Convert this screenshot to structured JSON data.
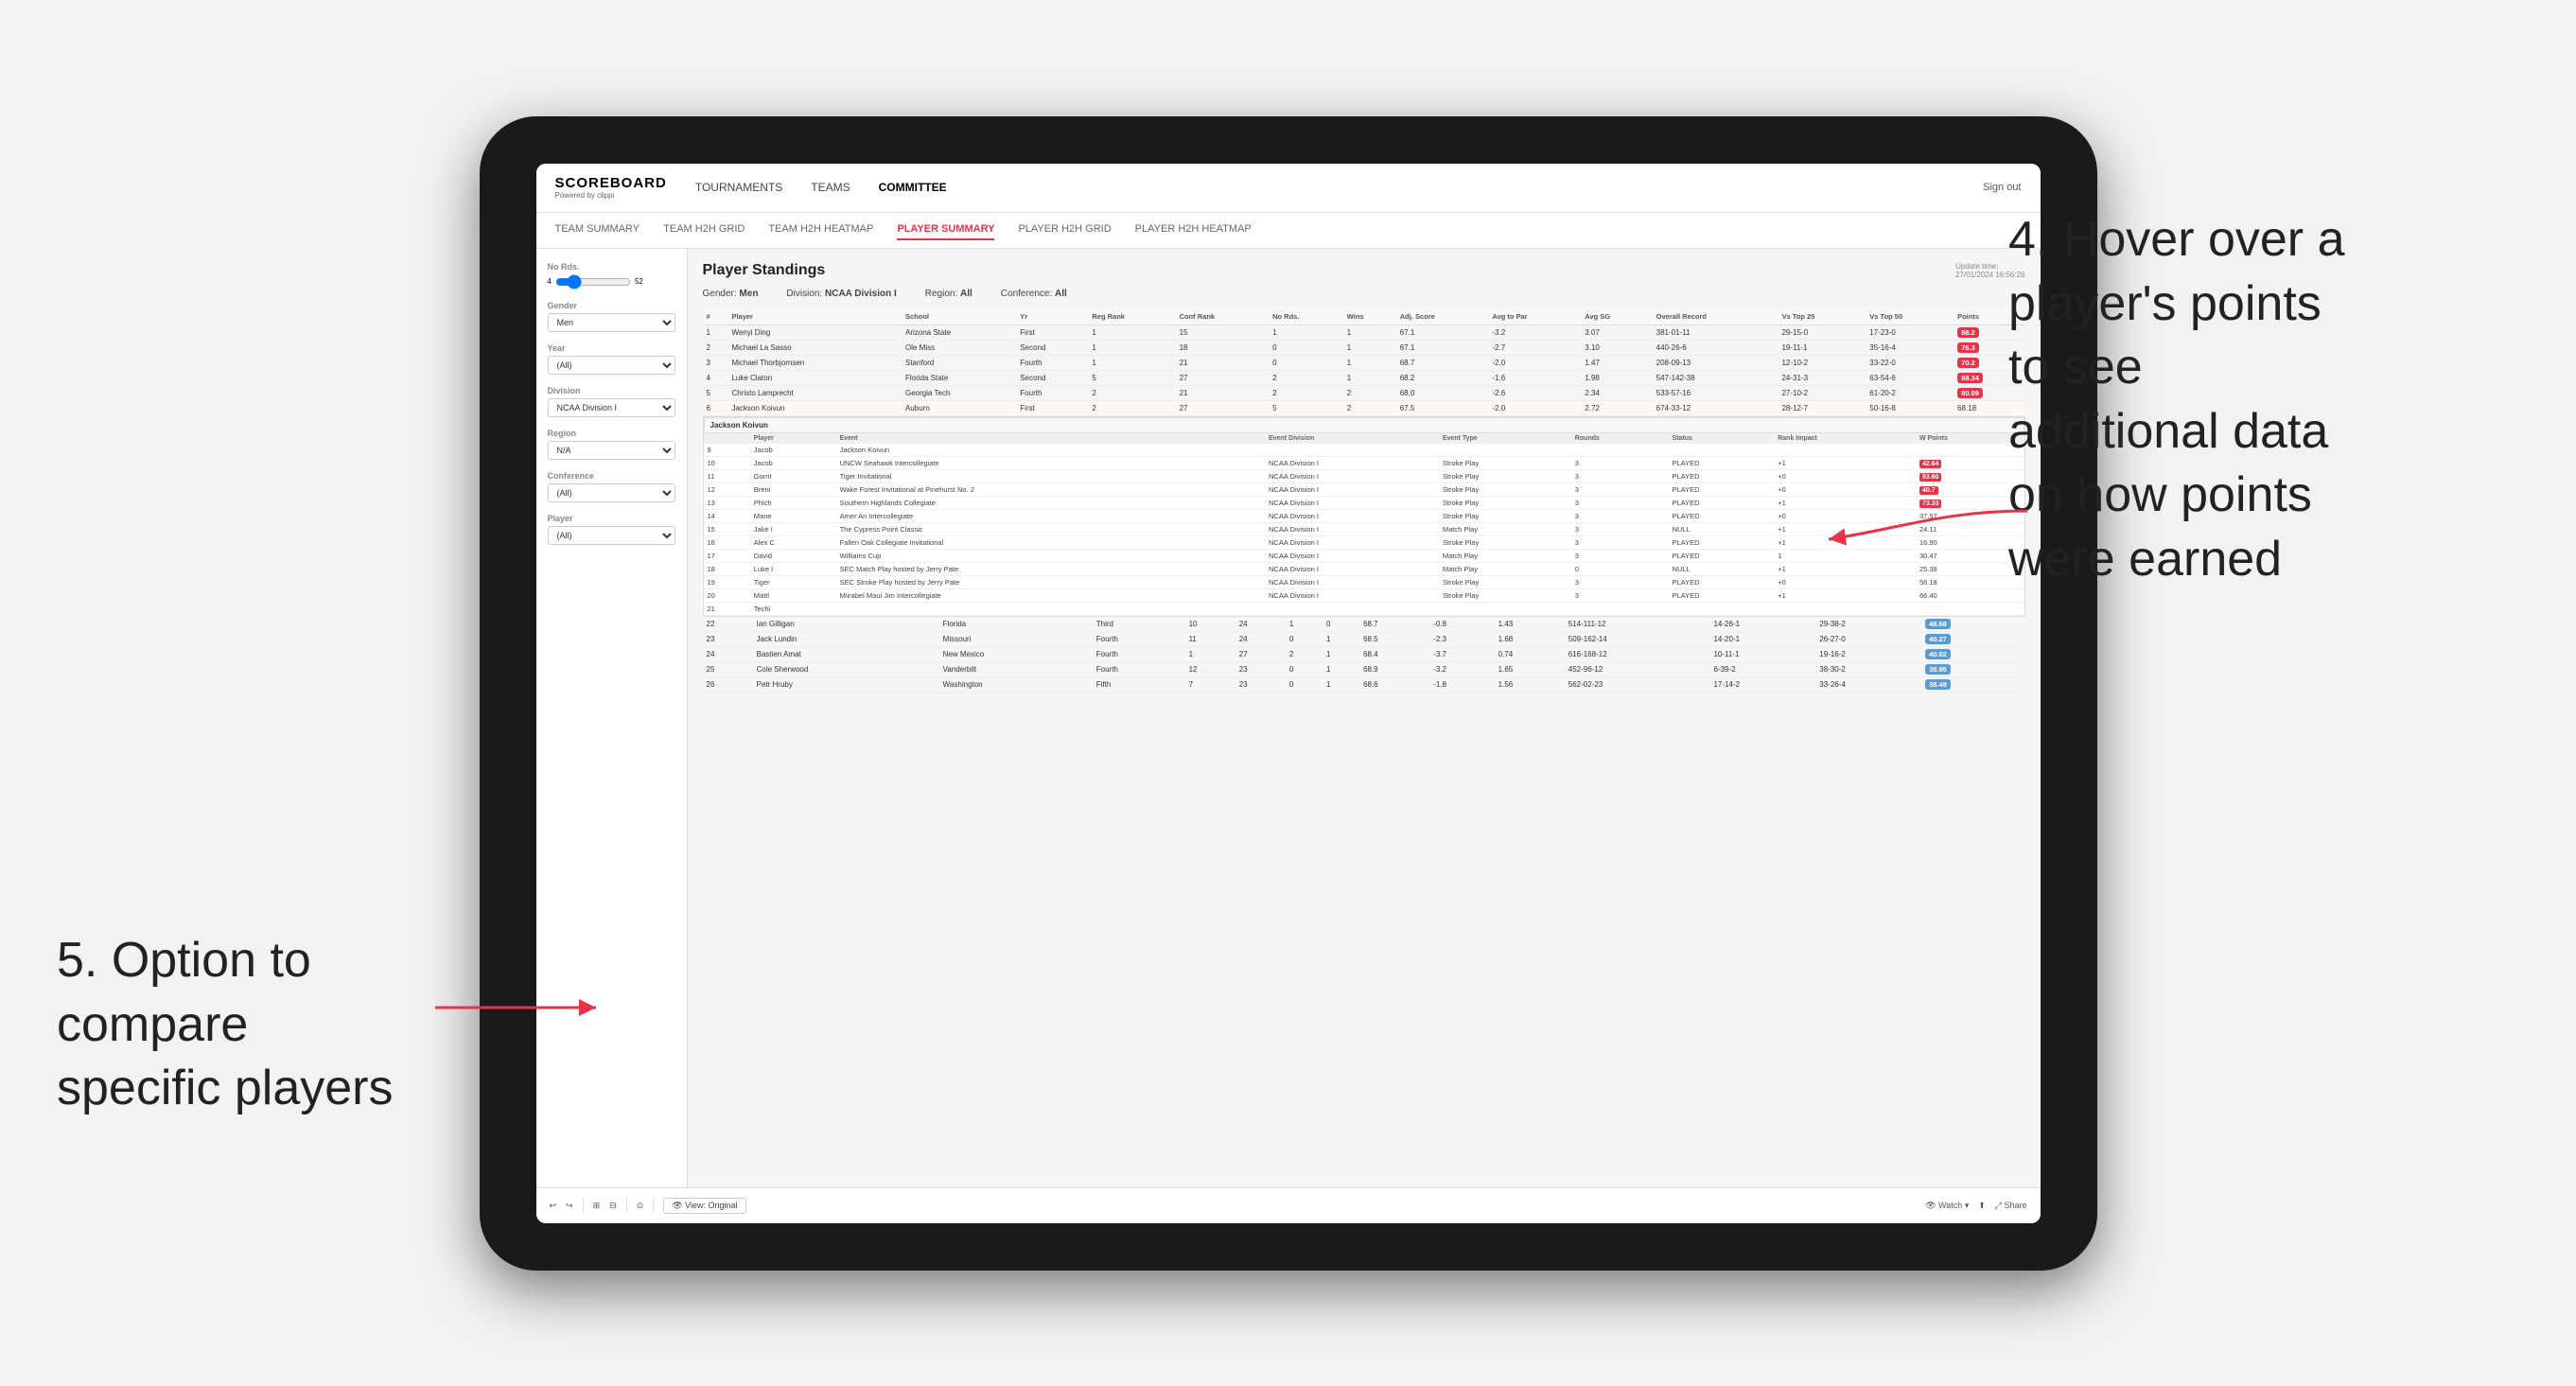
{
  "annotations": {
    "top_right": "4. Hover over a\nplayer's points\nto see\nadditional data\non how points\nwere earned",
    "bottom_left": "5. Option to\ncompare\nspecific players"
  },
  "nav": {
    "logo": "SCOREBOARD",
    "logo_sub": "Powered by clippi",
    "items": [
      "TOURNAMENTS",
      "TEAMS",
      "COMMITTEE"
    ],
    "sign_in": "Sign out"
  },
  "sub_nav": {
    "items": [
      "TEAM SUMMARY",
      "TEAM H2H GRID",
      "TEAM H2H HEATMAP",
      "PLAYER SUMMARY",
      "PLAYER H2H GRID",
      "PLAYER H2H HEATMAP"
    ],
    "active": "PLAYER SUMMARY"
  },
  "sidebar": {
    "no_rds_label": "No Rds.",
    "no_rds_from": "4",
    "no_rds_to": "52",
    "gender_label": "Gender",
    "gender_value": "Men",
    "year_label": "Year",
    "year_value": "(All)",
    "division_label": "Division",
    "division_value": "NCAA Division I",
    "region_label": "Region",
    "region_value": "N/A",
    "conference_label": "Conference",
    "conference_value": "(All)",
    "player_label": "Player",
    "player_value": "(All)"
  },
  "main": {
    "update_time": "Update time:",
    "update_date": "27/01/2024 16:56:26",
    "title": "Player Standings",
    "filters": {
      "gender": "Gender: Men",
      "division": "Division: NCAA Division I",
      "region": "Region: All",
      "conference": "Conference: All"
    },
    "table_headers": [
      "#",
      "Player",
      "School",
      "Yr",
      "Reg Rank",
      "Conf Rank",
      "No Rds.",
      "Wins",
      "Adj. Score",
      "Avg to Par",
      "Avg SG",
      "Overall Record",
      "Vs Top 25",
      "Vs Top 50",
      "Points"
    ],
    "rows": [
      {
        "rank": 1,
        "player": "Wenyi Ding",
        "school": "Arizona State",
        "yr": "First",
        "reg_rank": 1,
        "conf_rank": 15,
        "rds": 1,
        "wins": 1,
        "adj_score": 67.1,
        "to_par": -3.2,
        "avg_sg": 3.07,
        "record": "381-01-11",
        "vs25": "29-15-0",
        "vs50": "17-23-0",
        "points": "88.2",
        "points_type": "red"
      },
      {
        "rank": 2,
        "player": "Michael La Sasso",
        "school": "Ole Miss",
        "yr": "Second",
        "reg_rank": 1,
        "conf_rank": 18,
        "rds": 0,
        "wins": 1,
        "adj_score": 67.1,
        "to_par": -2.7,
        "avg_sg": 3.1,
        "record": "440-26-6",
        "vs25": "19-11-1",
        "vs50": "35-16-4",
        "points": "76.3",
        "points_type": "red"
      },
      {
        "rank": 3,
        "player": "Michael Thorbjornsen",
        "school": "Stanford",
        "yr": "Fourth",
        "reg_rank": 1,
        "conf_rank": 21,
        "rds": 0,
        "wins": 1,
        "adj_score": 68.7,
        "to_par": -2.0,
        "avg_sg": 1.47,
        "record": "208-09-13",
        "vs25": "12-10-2",
        "vs50": "33-22-0",
        "points": "70.2",
        "points_type": "red"
      },
      {
        "rank": 4,
        "player": "Luke Claton",
        "school": "Florida State",
        "yr": "Second",
        "reg_rank": 5,
        "conf_rank": 27,
        "rds": 2,
        "wins": 1,
        "adj_score": 68.2,
        "to_par": -1.6,
        "avg_sg": 1.98,
        "record": "547-142-38",
        "vs25": "24-31-3",
        "vs50": "63-54-6",
        "points": "88.34",
        "points_type": "red"
      },
      {
        "rank": 5,
        "player": "Christo Lamprecht",
        "school": "Georgia Tech",
        "yr": "Fourth",
        "reg_rank": 2,
        "conf_rank": 21,
        "rds": 2,
        "wins": 2,
        "adj_score": 68.0,
        "to_par": -2.6,
        "avg_sg": 2.34,
        "record": "533-57-16",
        "vs25": "27-10-2",
        "vs50": "61-20-2",
        "points": "80.09",
        "points_type": "red"
      },
      {
        "rank": 6,
        "player": "Jackson Koivun",
        "school": "Auburn",
        "yr": "First",
        "reg_rank": 2,
        "conf_rank": 27,
        "rds": 5,
        "wins": 2,
        "adj_score": 67.5,
        "to_par": -2.0,
        "avg_sg": 2.72,
        "record": "674-33-12",
        "vs25": "28-12-7",
        "vs50": "50-16-8",
        "points": "68.18",
        "points_type": "none"
      }
    ],
    "tooltip_player": "Jackson Koivun",
    "tooltip_rows": [
      {
        "event": "UNCW Seahawk Intercollegiate",
        "division": "NCAA Division I",
        "type": "Stroke Play",
        "rounds": 3,
        "status": "PLAYED",
        "rank_impact": "+1",
        "w_points": "42.64",
        "wp_type": "red"
      },
      {
        "event": "Tiger Invitational",
        "division": "NCAA Division I",
        "type": "Stroke Play",
        "rounds": 3,
        "status": "PLAYED",
        "rank_impact": "+0",
        "w_points": "53.60",
        "wp_type": "red"
      },
      {
        "event": "Wake Forest Invitational at Pinehurst No. 2",
        "division": "NCAA Division I",
        "type": "Stroke Play",
        "rounds": 3,
        "status": "PLAYED",
        "rank_impact": "+0",
        "w_points": "40.7",
        "wp_type": "red"
      },
      {
        "event": "Southern Highlands Collegiate",
        "division": "NCAA Division I",
        "type": "Stroke Play",
        "rounds": 3,
        "status": "PLAYED",
        "rank_impact": "+1",
        "w_points": "73.33",
        "wp_type": "red"
      },
      {
        "event": "Amer An Intercollegiate",
        "division": "NCAA Division I",
        "type": "Stroke Play",
        "rounds": 3,
        "status": "PLAYED",
        "rank_impact": "+0",
        "w_points": "37.57",
        "wp_type": "none"
      },
      {
        "event": "The Cypress Point Classic",
        "division": "NCAA Division I",
        "type": "Match Play",
        "rounds": 3,
        "status": "NULL",
        "rank_impact": "+1",
        "w_points": "24.11",
        "wp_type": "none"
      },
      {
        "event": "Fallen Oak Collegiate Invitational",
        "division": "NCAA Division I",
        "type": "Stroke Play",
        "rounds": 3,
        "status": "PLAYED",
        "rank_impact": "+1",
        "w_points": "16.90",
        "wp_type": "none"
      },
      {
        "event": "Williams Cup",
        "division": "NCAA Division I",
        "type": "Match Play",
        "rounds": 3,
        "status": "PLAYED",
        "rank_impact": "1",
        "w_points": "30.47",
        "wp_type": "none"
      },
      {
        "event": "SEC Match Play hosted by Jerry Pate",
        "division": "NCAA Division I",
        "type": "Match Play",
        "rounds": 0,
        "status": "NULL",
        "rank_impact": "+1",
        "w_points": "25.38",
        "wp_type": "none"
      },
      {
        "event": "SEC Stroke Play hosted by Jerry Pate",
        "division": "NCAA Division I",
        "type": "Stroke Play",
        "rounds": 3,
        "status": "PLAYED",
        "rank_impact": "+0",
        "w_points": "56.18",
        "wp_type": "none"
      },
      {
        "event": "Miirabel Maui Jim Intercollegiate",
        "division": "NCAA Division I",
        "type": "Stroke Play",
        "rounds": 3,
        "status": "PLAYED",
        "rank_impact": "+1",
        "w_points": "66.40",
        "wp_type": "none"
      }
    ],
    "lower_rows": [
      {
        "rank": 22,
        "player": "Ian Gilligan",
        "school": "Florida",
        "yr": "Third",
        "reg_rank": 10,
        "conf_rank": 24,
        "rds": 1,
        "wins": 0,
        "adj_score": 68.7,
        "to_par": -0.8,
        "avg_sg": 1.43,
        "record": "514-111-12",
        "vs25": "14-26-1",
        "vs50": "29-38-2",
        "points": "48.68",
        "points_type": "blue"
      },
      {
        "rank": 23,
        "player": "Jack Lundin",
        "school": "Missouri",
        "yr": "Fourth",
        "reg_rank": 11,
        "conf_rank": 24,
        "rds": 0,
        "wins": 1,
        "adj_score": 68.5,
        "to_par": -2.3,
        "avg_sg": 1.68,
        "record": "509-162-14",
        "vs25": "14-20-1",
        "vs50": "26-27-0",
        "points": "40.27",
        "points_type": "blue"
      },
      {
        "rank": 24,
        "player": "Bastien Amat",
        "school": "New Mexico",
        "yr": "Fourth",
        "reg_rank": 1,
        "conf_rank": 27,
        "rds": 2,
        "wins": 1,
        "adj_score": 68.4,
        "to_par": -3.7,
        "avg_sg": 0.74,
        "record": "616-168-12",
        "vs25": "10-11-1",
        "vs50": "19-16-2",
        "points": "40.02",
        "points_type": "blue"
      },
      {
        "rank": 25,
        "player": "Cole Sherwood",
        "school": "Vanderbilt",
        "yr": "Fourth",
        "reg_rank": 12,
        "conf_rank": 23,
        "rds": 0,
        "wins": 1,
        "adj_score": 68.9,
        "to_par": -3.2,
        "avg_sg": 1.65,
        "record": "452-96-12",
        "vs25": "6-39-2",
        "vs50": "38-30-2",
        "points": "38.95",
        "points_type": "blue"
      },
      {
        "rank": 26,
        "player": "Petr Hruby",
        "school": "Washington",
        "yr": "Fifth",
        "reg_rank": 7,
        "conf_rank": 23,
        "rds": 0,
        "wins": 1,
        "adj_score": 68.6,
        "to_par": -1.8,
        "avg_sg": 1.56,
        "record": "562-02-23",
        "vs25": "17-14-2",
        "vs50": "33-26-4",
        "points": "38.49",
        "points_type": "blue"
      }
    ]
  },
  "toolbar": {
    "undo": "↩",
    "redo": "↪",
    "view_original": "View: Original",
    "watch": "Watch",
    "share": "Share"
  }
}
